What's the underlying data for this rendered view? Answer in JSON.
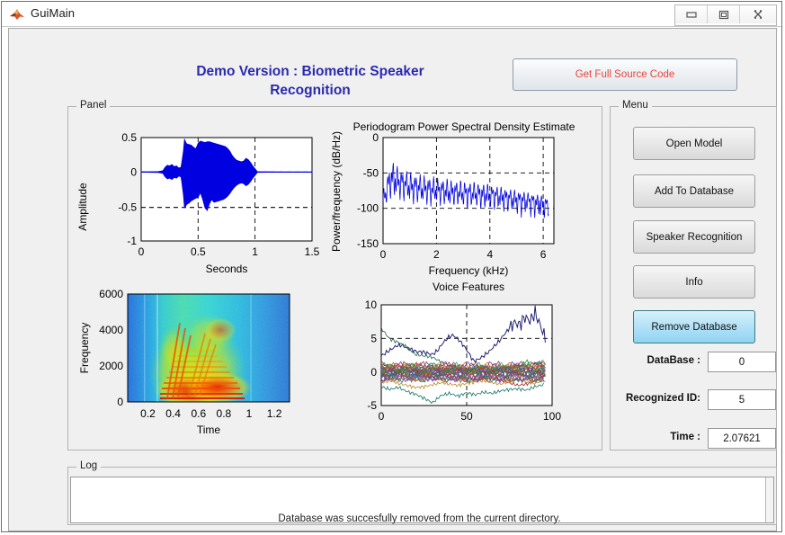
{
  "window": {
    "title": "GuiMain",
    "icon": "matlab-icon",
    "controls": [
      {
        "name": "minimize-button",
        "glyph": "minimize-icon"
      },
      {
        "name": "restore-button",
        "glyph": "restore-icon"
      },
      {
        "name": "close-button",
        "glyph": "close-icon"
      }
    ]
  },
  "header": {
    "title_line1": "Demo Version : Biometric Speaker",
    "title_line2": "Recognition",
    "title_color": "#2a2ab0",
    "source_button_label": "Get Full Source Code",
    "source_button_color": "#e8443c"
  },
  "panel": {
    "label": "Panel"
  },
  "menu": {
    "label": "Menu",
    "buttons": [
      {
        "label": "Open Model",
        "selected": false
      },
      {
        "label": "Add To Database",
        "selected": false
      },
      {
        "label": "Speaker Recognition",
        "selected": false
      },
      {
        "label": "Info",
        "selected": false
      },
      {
        "label": "Remove Database",
        "selected": true
      }
    ],
    "fields": [
      {
        "label": "DataBase :",
        "value": "0"
      },
      {
        "label": "Recognized ID:",
        "value": "5"
      },
      {
        "label": "Time :",
        "value": "2.07621"
      }
    ],
    "selected_color": "#8fd3f2"
  },
  "log": {
    "label": "Log",
    "message": "Database was succesfully removed from the current directory."
  },
  "chart_data": [
    {
      "type": "area",
      "name": "waveform",
      "title": "",
      "xlabel": "Seconds",
      "ylabel": "Amplitude",
      "xlim": [
        0,
        1.5
      ],
      "ylim": [
        -1,
        0.5
      ],
      "xticks": [
        0,
        0.5,
        1,
        1.5
      ],
      "xticklabels": [
        "0",
        "0.5",
        "1",
        "1.5"
      ],
      "yticks": [
        -1,
        -0.5,
        0,
        0.5
      ],
      "yticklabels": [
        "-1",
        "-0.5",
        "0",
        "0.5"
      ],
      "grid": true,
      "color": "#0000e0",
      "envelope_x": [
        0.0,
        0.05,
        0.1,
        0.15,
        0.19,
        0.21,
        0.23,
        0.25,
        0.27,
        0.29,
        0.31,
        0.33,
        0.35,
        0.37,
        0.38,
        0.39,
        0.4,
        0.42,
        0.44,
        0.46,
        0.48,
        0.5,
        0.52,
        0.54,
        0.56,
        0.58,
        0.6,
        0.62,
        0.64,
        0.66,
        0.68,
        0.7,
        0.72,
        0.74,
        0.76,
        0.78,
        0.8,
        0.82,
        0.84,
        0.86,
        0.88,
        0.9,
        0.92,
        0.94,
        0.96,
        0.98,
        1.0,
        1.02,
        1.1,
        1.25,
        1.5
      ],
      "envelope_top": [
        0.005,
        0.005,
        0.006,
        0.008,
        0.02,
        0.07,
        0.1,
        0.09,
        0.11,
        0.08,
        0.09,
        0.06,
        0.07,
        0.3,
        0.48,
        0.44,
        0.41,
        0.4,
        0.39,
        0.36,
        0.34,
        0.42,
        0.45,
        0.44,
        0.43,
        0.44,
        0.44,
        0.43,
        0.42,
        0.41,
        0.4,
        0.39,
        0.38,
        0.37,
        0.34,
        0.3,
        0.24,
        0.2,
        0.17,
        0.16,
        0.15,
        0.16,
        0.2,
        0.18,
        0.14,
        0.09,
        0.05,
        0.006,
        0.005,
        0.004,
        0.004
      ],
      "envelope_bottom": [
        -0.005,
        -0.005,
        -0.006,
        -0.008,
        -0.02,
        -0.07,
        -0.1,
        -0.09,
        -0.11,
        -0.08,
        -0.09,
        -0.06,
        -0.07,
        -0.33,
        -0.52,
        -0.5,
        -0.47,
        -0.45,
        -0.42,
        -0.4,
        -0.38,
        -0.37,
        -0.3,
        -0.4,
        -0.52,
        -0.56,
        -0.46,
        -0.4,
        -0.44,
        -0.43,
        -0.42,
        -0.41,
        -0.4,
        -0.38,
        -0.35,
        -0.31,
        -0.26,
        -0.22,
        -0.19,
        -0.17,
        -0.16,
        -0.17,
        -0.2,
        -0.18,
        -0.14,
        -0.09,
        -0.05,
        -0.006,
        -0.005,
        -0.004,
        -0.004
      ]
    },
    {
      "type": "line",
      "name": "psd",
      "title": "Periodogram Power Spectral Density Estimate",
      "xlabel": "Frequency (kHz)",
      "ylabel": "Power/frequency (dB/Hz)",
      "xlim": [
        0,
        6.4
      ],
      "ylim": [
        -150,
        0
      ],
      "xticks": [
        0,
        2,
        4,
        6
      ],
      "xticklabels": [
        "0",
        "2",
        "4",
        "6"
      ],
      "yticks": [
        -150,
        -100,
        -50,
        0
      ],
      "yticklabels": [
        "-150",
        "-100",
        "-50",
        "0"
      ],
      "grid": true,
      "color": "#0000e0",
      "trend_x": [
        0.0,
        0.3,
        0.6,
        1.0,
        1.5,
        2.0,
        2.5,
        3.0,
        3.5,
        4.0,
        4.5,
        5.0,
        5.5,
        6.0,
        6.2
      ],
      "trend_y": [
        -90,
        -55,
        -62,
        -68,
        -72,
        -74,
        -76,
        -78,
        -79,
        -80,
        -83,
        -86,
        -88,
        -92,
        -95
      ],
      "band_hi": [
        -75,
        -30,
        -42,
        -48,
        -52,
        -55,
        -58,
        -60,
        -62,
        -65,
        -70,
        -74,
        -78,
        -82,
        -85
      ],
      "band_lo": [
        -105,
        -98,
        -100,
        -102,
        -103,
        -104,
        -105,
        -106,
        -108,
        -110,
        -112,
        -118,
        -122,
        -126,
        -120
      ]
    },
    {
      "type": "heatmap",
      "name": "spectrogram",
      "title": "",
      "xlabel": "Time",
      "ylabel": "Frequency",
      "xlim": [
        0.04,
        1.32
      ],
      "ylim": [
        0,
        6000
      ],
      "xticks": [
        0.2,
        0.4,
        0.6,
        0.8,
        1.0,
        1.2
      ],
      "xticklabels": [
        "0.2",
        "0.4",
        "0.6",
        "0.8",
        "1",
        "1.2"
      ],
      "yticks": [
        0,
        2000,
        4000,
        6000
      ],
      "yticklabels": [
        "0",
        "2000",
        "4000",
        "6000"
      ],
      "colormap": "jet",
      "grid": false
    },
    {
      "type": "line",
      "name": "voice-features",
      "title": "Voice Features",
      "xlabel": "",
      "ylabel": "",
      "xlim": [
        0,
        100
      ],
      "ylim": [
        -5,
        10
      ],
      "xticks": [
        0,
        50,
        100
      ],
      "xticklabels": [
        "0",
        "50",
        "100"
      ],
      "yticks": [
        -5,
        0,
        5,
        10
      ],
      "yticklabels": [
        "-5",
        "0",
        "5",
        "10"
      ],
      "grid": true,
      "series": [
        {
          "name": "c1",
          "color": "#1a1a6e",
          "x": [
            0,
            3,
            6,
            9,
            12,
            15,
            18,
            21,
            24,
            27,
            30,
            33,
            36,
            39,
            42,
            45,
            48,
            51,
            54,
            57,
            60,
            63,
            66,
            69,
            72,
            75,
            78,
            81,
            84,
            87,
            90,
            93,
            96
          ],
          "y": [
            2.4,
            2.9,
            3.4,
            3.9,
            4.0,
            3.6,
            3.3,
            3.0,
            3.0,
            2.8,
            2.6,
            3.2,
            4.3,
            5.1,
            5.5,
            4.9,
            4.0,
            2.9,
            1.6,
            1.9,
            2.4,
            3.0,
            3.8,
            4.6,
            5.6,
            6.5,
            7.4,
            7.0,
            8.2,
            7.6,
            8.8,
            7.0,
            5.0
          ]
        },
        {
          "name": "c2",
          "color": "#2e6b4f",
          "x": [
            0,
            5,
            10,
            15,
            20,
            25,
            30,
            35,
            40,
            45,
            50,
            55,
            60,
            65,
            70,
            75,
            80,
            85,
            90,
            95
          ],
          "y": [
            6.5,
            4.9,
            4.4,
            3.7,
            2.6,
            2.4,
            2.2,
            1.5,
            0.9,
            0.6,
            0.3,
            0.2,
            0.1,
            0.3,
            0.4,
            0.5,
            0.8,
            1.1,
            1.3,
            1.0
          ]
        },
        {
          "name": "c3",
          "color": "#1f7a6e",
          "x": [
            0,
            5,
            10,
            15,
            20,
            25,
            30,
            35,
            40,
            45,
            50,
            55,
            60,
            65,
            70,
            75,
            80,
            85,
            90,
            95
          ],
          "y": [
            -2.2,
            -2.6,
            -2.3,
            -2.9,
            -3.3,
            -3.9,
            -4.6,
            -3.5,
            -3.2,
            -3.6,
            -3.1,
            -3.4,
            -3.0,
            -3.2,
            -2.8,
            -2.6,
            -2.5,
            -2.7,
            -2.2,
            -1.9
          ]
        },
        {
          "name": "c4",
          "color": "#a03030",
          "x": [
            0,
            5,
            10,
            15,
            20,
            25,
            30,
            35,
            40,
            45,
            50,
            55,
            60,
            65,
            70,
            75,
            80,
            85,
            90,
            95
          ],
          "y": [
            -0.9,
            0.6,
            1.0,
            0.4,
            -0.4,
            -0.8,
            -0.6,
            -1.0,
            -0.8,
            -1.1,
            -0.9,
            -1.2,
            -1.0,
            -0.8,
            -1.2,
            -1.6,
            -2.0,
            -1.8,
            -1.4,
            -0.6
          ]
        },
        {
          "name": "c5",
          "color": "#c08a2e",
          "x": [
            0,
            5,
            10,
            15,
            20,
            25,
            30,
            35,
            40,
            45,
            50,
            55,
            60,
            65,
            70,
            75,
            80,
            85,
            90,
            95
          ],
          "y": [
            -1.6,
            -1.3,
            -1.7,
            -2.0,
            -2.3,
            -2.2,
            -1.9,
            -1.6,
            -1.8,
            -2.0,
            -1.7,
            -1.5,
            -1.3,
            -1.6,
            -1.8,
            -1.4,
            -1.2,
            -1.5,
            -1.7,
            -1.2
          ]
        },
        {
          "name": "c6",
          "color": "#3a8f3a",
          "x": [
            0,
            10,
            20,
            30,
            40,
            50,
            60,
            70,
            80,
            85,
            90,
            95
          ],
          "y": [
            -0.4,
            -0.2,
            0.1,
            -0.3,
            0.2,
            0.4,
            0.1,
            0.3,
            0.8,
            1.6,
            1.2,
            1.7
          ]
        },
        {
          "name": "c7",
          "color": "#7040a0",
          "x": [
            0,
            10,
            20,
            30,
            40,
            50,
            60,
            70,
            80,
            90,
            95
          ],
          "y": [
            0.4,
            0.2,
            0.5,
            0.1,
            0.3,
            0.2,
            0.4,
            0.1,
            0.3,
            0.5,
            0.2
          ]
        },
        {
          "name": "c8",
          "color": "#2060c0",
          "x": [
            0,
            10,
            20,
            30,
            40,
            50,
            60,
            70,
            80,
            90,
            95
          ],
          "y": [
            -0.2,
            0.3,
            -0.1,
            0.4,
            -0.2,
            0.3,
            -0.1,
            0.2,
            -0.3,
            0.1,
            -0.2
          ]
        },
        {
          "name": "c9",
          "color": "#c04080",
          "x": [
            0,
            10,
            20,
            30,
            40,
            50,
            60,
            70,
            80,
            90,
            95
          ],
          "y": [
            -0.7,
            -0.5,
            -0.8,
            -0.4,
            -0.6,
            -0.9,
            -0.5,
            -0.7,
            -0.4,
            -0.8,
            -0.5
          ]
        },
        {
          "name": "c10",
          "color": "#20a0a0",
          "x": [
            0,
            10,
            20,
            30,
            40,
            50,
            60,
            70,
            80,
            90,
            95
          ],
          "y": [
            0.7,
            0.4,
            0.8,
            0.5,
            0.6,
            0.3,
            0.7,
            0.5,
            0.9,
            0.4,
            0.8
          ]
        },
        {
          "name": "c11",
          "color": "#806020",
          "x": [
            0,
            10,
            20,
            30,
            40,
            50,
            60,
            70,
            80,
            90,
            95
          ],
          "y": [
            -1.2,
            -0.9,
            -1.3,
            -1.0,
            -1.1,
            -1.4,
            -0.9,
            -1.2,
            -1.0,
            -1.3,
            -0.9
          ]
        },
        {
          "name": "c12",
          "color": "#d06020",
          "x": [
            0,
            10,
            20,
            30,
            40,
            50,
            60,
            70,
            80,
            90,
            95
          ],
          "y": [
            1.1,
            0.8,
            1.2,
            0.6,
            0.9,
            0.5,
            0.8,
            0.6,
            1.0,
            0.7,
            1.1
          ]
        }
      ]
    }
  ]
}
